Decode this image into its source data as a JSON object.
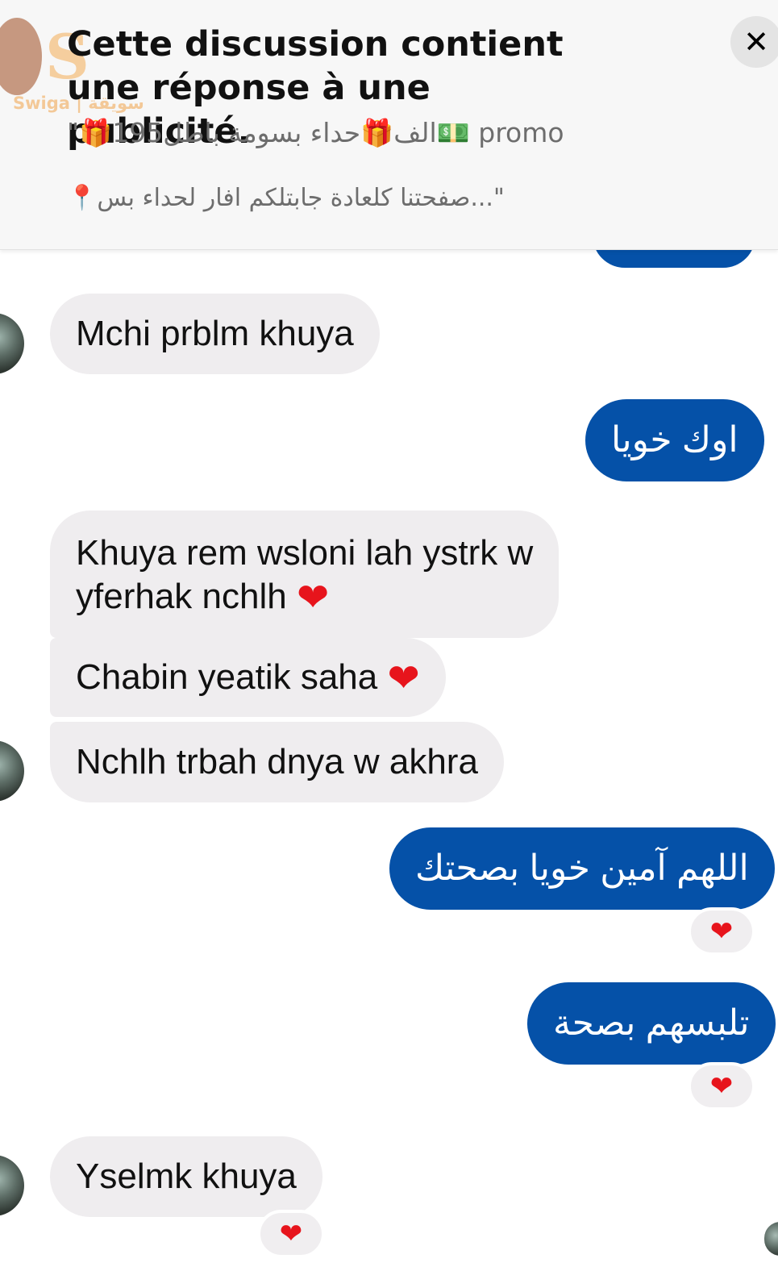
{
  "banner": {
    "title": "Cette discussion contient une réponse à une publicité.",
    "quote_line1": "\"🎁195الف🎁حداء بسومة باطل💵 promo",
    "quote_line2": "📍صفحتنا كلعادة جابتلكم افار لحداء بس...\"",
    "watermark": "Swiga | سويقة",
    "close_label": "✕"
  },
  "messages": [
    {
      "id": 1,
      "side": "received",
      "text": "Mchi prblm khuya"
    },
    {
      "id": 2,
      "side": "sent",
      "text": "اوك خويا"
    },
    {
      "id": 3,
      "side": "received",
      "text_line1": "Khuya rem wsloni lah ystrk w",
      "text_line2": "yferhak nchlh",
      "emoji": "heart"
    },
    {
      "id": 4,
      "side": "received",
      "text": "Chabin yeatik saha",
      "emoji": "heart"
    },
    {
      "id": 5,
      "side": "received",
      "text": "Nchlh trbah dnya w akhra"
    },
    {
      "id": 6,
      "side": "sent",
      "text": "اللهم آمين خويا بصحتك",
      "reaction": "heart"
    },
    {
      "id": 7,
      "side": "sent",
      "text": "تلبسهم بصحة",
      "reaction": "heart"
    },
    {
      "id": 8,
      "side": "received",
      "text": "Yselmk khuya",
      "reaction": "heart"
    }
  ],
  "emoji": {
    "heart": "❤"
  },
  "colors": {
    "sent_bubble": "#0551a8",
    "received_bubble": "#efedef",
    "banner_bg": "#f7f7f7",
    "heart": "#e7141c"
  }
}
